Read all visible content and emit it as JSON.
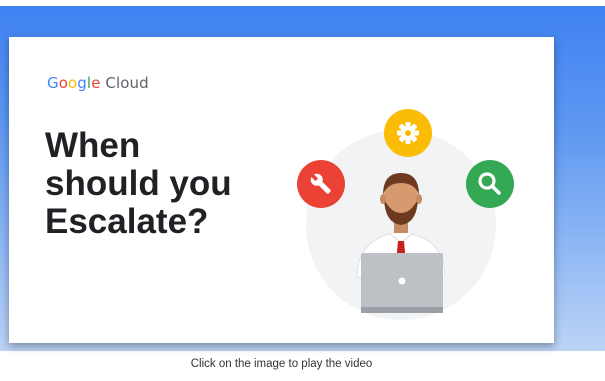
{
  "thumbnail": {
    "brand": {
      "google_letters": [
        "G",
        "o",
        "o",
        "g",
        "l",
        "e"
      ],
      "product": "Cloud"
    },
    "headline_lines": [
      "When",
      "should you",
      "Escalate?"
    ],
    "icons": {
      "left": "wrench-icon",
      "top": "gear-icon",
      "right": "search-icon"
    },
    "colors": {
      "red": "#ea4335",
      "yellow": "#fbbc05",
      "green": "#34a853",
      "blue": "#4285f4"
    }
  },
  "caption": "Click on the image to play the video"
}
